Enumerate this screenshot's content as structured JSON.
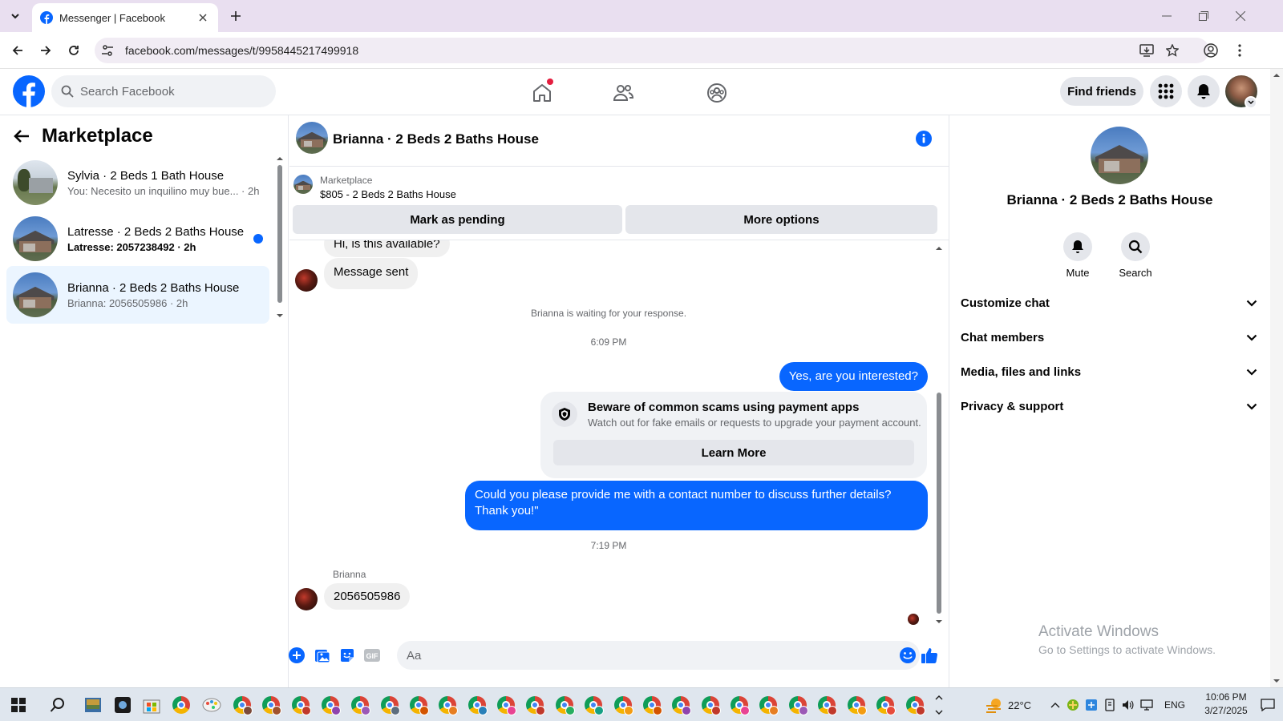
{
  "browser": {
    "tab_title": "Messenger | Facebook",
    "url": "facebook.com/messages/t/9958445217499918"
  },
  "fb_header": {
    "search_placeholder": "Search Facebook",
    "find_friends_label": "Find friends"
  },
  "left_panel": {
    "title": "Marketplace",
    "conversations": [
      {
        "title": "Sylvia · 2 Beds 1 Bath House",
        "subtitle": "You: Necesito un inquilino muy bue... · 2h",
        "unread": false,
        "active": false
      },
      {
        "title": "Latresse · 2 Beds 2 Baths House",
        "subtitle": "Latresse: 2057238492 · 2h",
        "unread": true,
        "active": false
      },
      {
        "title": "Brianna · 2 Beds 2 Baths House",
        "subtitle": "Brianna: 2056505986 · 2h",
        "unread": false,
        "active": true
      }
    ]
  },
  "chat": {
    "title": "Brianna · 2 Beds 2 Baths House",
    "marketplace_label": "Marketplace",
    "listing": "$805 - 2 Beds 2 Baths House",
    "mark_pending_label": "Mark as pending",
    "more_options_label": "More options",
    "messages": {
      "m1": "Hi, is this available?",
      "m2": "Message sent",
      "waiting": "Brianna is waiting for your response.",
      "time1": "6:09 PM",
      "m3": "Yes, are you interested?",
      "scam_title": "Beware of common scams using payment apps",
      "scam_sub": "Watch out for fake emails or requests to upgrade your payment account.",
      "learn_more": "Learn More",
      "m4": "Could you please provide me with a contact number to discuss further details? Thank you!\"",
      "time2": "7:19 PM",
      "sender_name": "Brianna",
      "m5": "2056505986"
    },
    "composer_placeholder": "Aa"
  },
  "right_panel": {
    "name": "Brianna · 2 Beds 2 Baths House",
    "mute_label": "Mute",
    "search_label": "Search",
    "sections": [
      "Customize chat",
      "Chat members",
      "Media, files and links",
      "Privacy & support"
    ]
  },
  "watermark": {
    "line1": "Activate Windows",
    "line2": "Go to Settings to activate Windows."
  },
  "taskbar": {
    "temperature": "22°C",
    "language": "ENG",
    "time": "10:06 PM",
    "date": "3/27/2025"
  },
  "colors": {
    "accent": "#0866ff",
    "fb_blue": "#0866ff",
    "tab_strip": "#e9dff0"
  }
}
